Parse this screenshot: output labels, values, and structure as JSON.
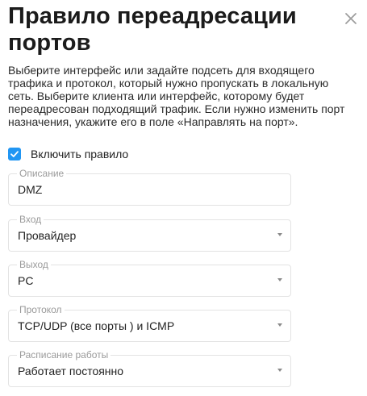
{
  "dialog": {
    "title": "Правило переадресации портов",
    "description": "Выберите интерфейс или задайте подсеть для входящего трафика и протокол, который нужно пропускать в локальную сеть. Выберите клиента или интерфейс, которому будет переадресован подходящий трафик. Если нужно изменить порт назначения, укажите его в поле «Направлять на порт».",
    "close_icon": "close-icon"
  },
  "enable_rule": {
    "label": "Включить правило",
    "checked": true,
    "color": "#2196f3"
  },
  "fields": {
    "description": {
      "label": "Описание",
      "value": "DMZ"
    },
    "input": {
      "label": "Вход",
      "value": "Провайдер"
    },
    "output": {
      "label": "Выход",
      "value": "PC"
    },
    "protocol": {
      "label": "Протокол",
      "value": "TCP/UDP (все порты ) и ICMP"
    },
    "schedule": {
      "label": "Расписание работы",
      "value": "Работает постоянно"
    }
  }
}
